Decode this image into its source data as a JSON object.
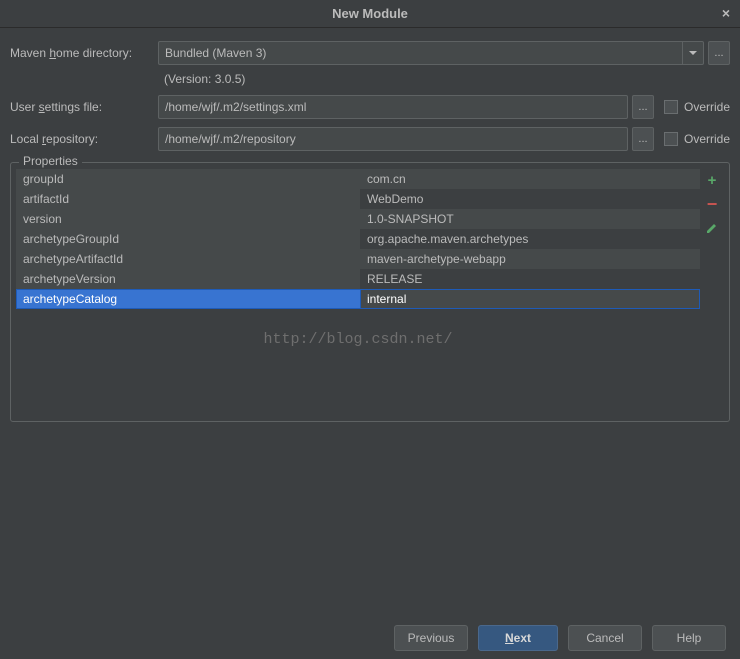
{
  "window": {
    "title": "New Module"
  },
  "form": {
    "maven_home_label_pre": "Maven ",
    "maven_home_label_u": "h",
    "maven_home_label_post": "ome directory:",
    "maven_home_value": "Bundled (Maven 3)",
    "maven_version": "(Version: 3.0.5)",
    "user_settings_label_pre": "User ",
    "user_settings_label_u": "s",
    "user_settings_label_post": "ettings file:",
    "user_settings_value": "/home/wjf/.m2/settings.xml",
    "local_repo_label_pre": "Local ",
    "local_repo_label_u": "r",
    "local_repo_label_post": "epository:",
    "local_repo_value": "/home/wjf/.m2/repository",
    "override_label": "Override",
    "browse_label": "..."
  },
  "properties": {
    "legend": "Properties",
    "rows": [
      {
        "key": "groupId",
        "value": "com.cn"
      },
      {
        "key": "artifactId",
        "value": "WebDemo"
      },
      {
        "key": "version",
        "value": "1.0-SNAPSHOT"
      },
      {
        "key": "archetypeGroupId",
        "value": "org.apache.maven.archetypes"
      },
      {
        "key": "archetypeArtifactId",
        "value": "maven-archetype-webapp"
      },
      {
        "key": "archetypeVersion",
        "value": "RELEASE"
      },
      {
        "key": "archetypeCatalog",
        "value": "internal"
      }
    ],
    "selected_index": 6
  },
  "watermark": "http://blog.csdn.net/",
  "buttons": {
    "previous": "Previous",
    "next_u": "N",
    "next_rest": "ext",
    "cancel": "Cancel",
    "help": "Help"
  }
}
